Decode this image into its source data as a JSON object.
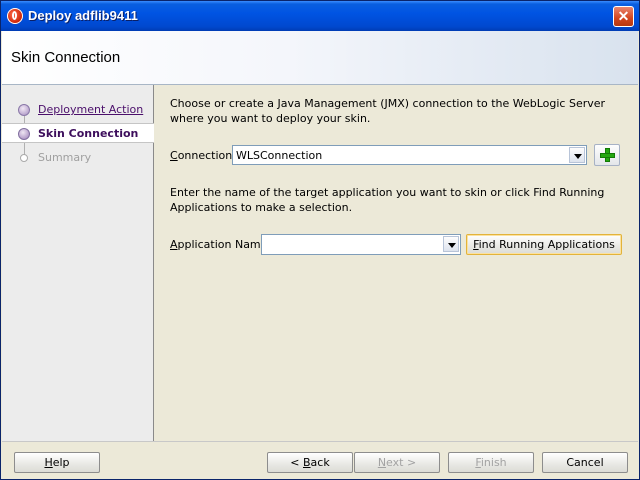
{
  "window": {
    "title": "Deploy adflib9411",
    "close_glyph": "✕"
  },
  "header": {
    "title": "Skin Connection"
  },
  "nav": {
    "items": [
      {
        "label": "Deployment Action",
        "state": "done"
      },
      {
        "label": "Skin Connection",
        "state": "current"
      },
      {
        "label": "Summary",
        "state": "future"
      }
    ]
  },
  "main": {
    "intro": "Choose or create a Java Management (JMX) connection to the WebLogic Server where you want to deploy your skin.",
    "connection": {
      "label_accel": "C",
      "label_rest": "onnection:",
      "value": "WLSConnection"
    },
    "app_intro": "Enter the name of the target application you want to skin or click Find Running Applications to make a selection.",
    "application": {
      "label_accel": "A",
      "label_rest": "pplication Name:",
      "value": ""
    },
    "find_button": {
      "accel": "F",
      "rest": "ind Running Applications"
    }
  },
  "footer": {
    "help": {
      "accel": "H",
      "rest": "elp"
    },
    "back": {
      "pre": "< ",
      "accel": "B",
      "rest": "ack"
    },
    "next": {
      "accel": "N",
      "rest": "ext >"
    },
    "finish": {
      "accel": "F",
      "rest": "inish"
    },
    "cancel": "Cancel"
  },
  "colors": {
    "titlebar": "#0054e3",
    "visited_link": "#4b0f6b",
    "focus_border": "#e3b33a",
    "add_icon": "#23a60f"
  },
  "icons": {
    "app": "oracle-o-icon",
    "add": "green-plus-icon",
    "close": "close-icon"
  }
}
